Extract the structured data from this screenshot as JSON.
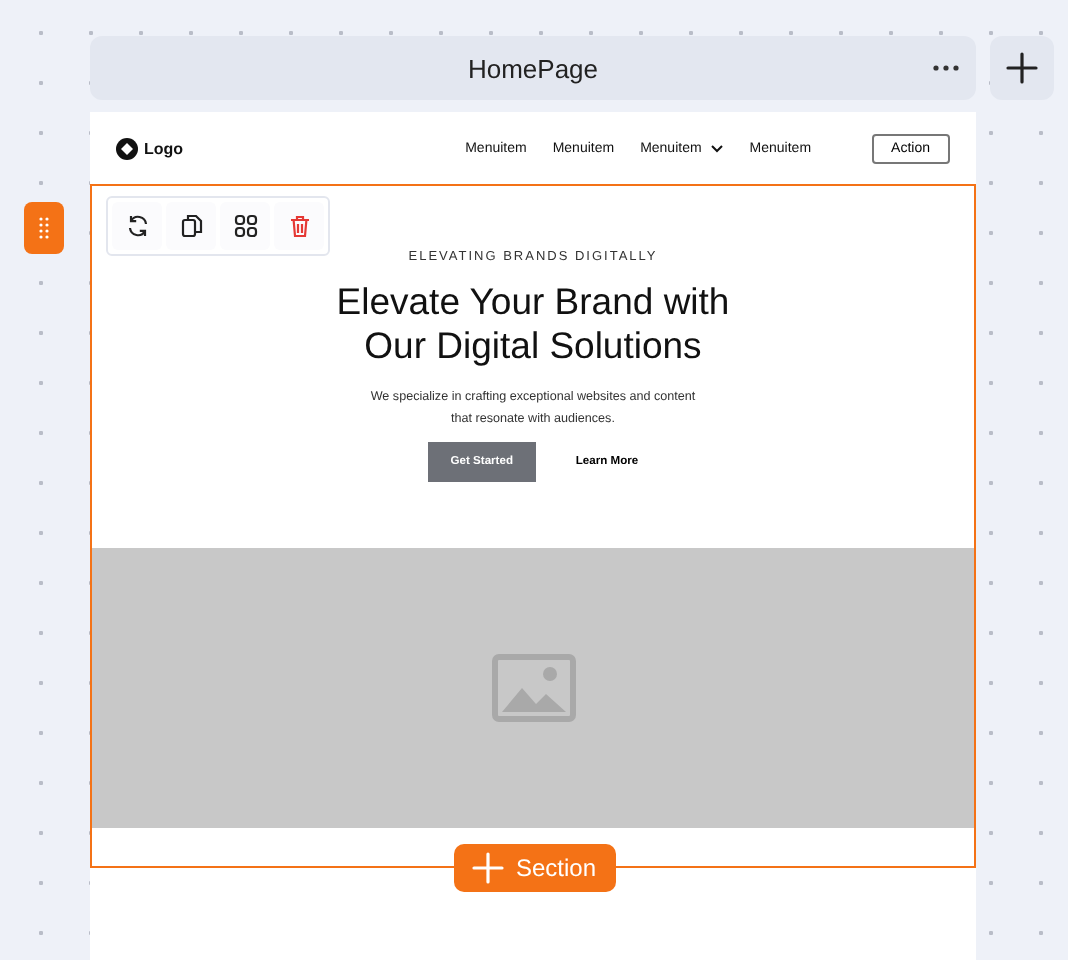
{
  "header": {
    "title": "HomePage"
  },
  "nav": {
    "logo": "Logo",
    "items": [
      {
        "label": "Menuitem",
        "dropdown": false
      },
      {
        "label": "Menuitem",
        "dropdown": false
      },
      {
        "label": "Menuitem",
        "dropdown": true
      },
      {
        "label": "Menuitem",
        "dropdown": false
      }
    ],
    "action": "Action"
  },
  "hero": {
    "eyebrow": "ELEVATING BRANDS DIGITALLY",
    "title_lines": [
      "Elevate Your Brand with",
      "Our Digital Solutions"
    ],
    "description_lines": [
      "We specialize in crafting exceptional websites and content",
      "that resonate with audiences."
    ],
    "primary": "Get Started",
    "secondary": "Learn More"
  },
  "section_button": "Section"
}
